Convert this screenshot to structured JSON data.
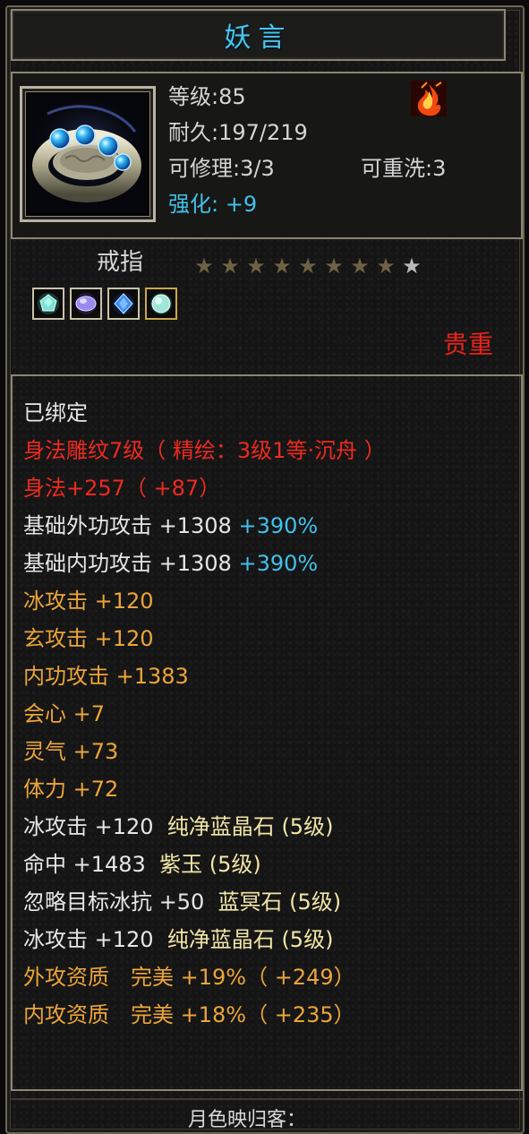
{
  "item": {
    "name": "妖言",
    "level": "等级:85",
    "durability": "耐久:197/219",
    "repairable": "可修理:3/3",
    "rewashable": "可重洗:3",
    "enhance_label": "强化:",
    "enhance_value": "+9",
    "type": "戒指",
    "rarity": "贵重",
    "stars": {
      "filled": 8,
      "total": 9
    },
    "gems": [
      {
        "icon": "green-gem-icon",
        "color": "#7be0d6"
      },
      {
        "icon": "purple-gem-icon",
        "color": "#9a8af0"
      },
      {
        "icon": "blue-gem-icon",
        "color": "#3a8ef0"
      },
      {
        "icon": "aqua-gem-icon",
        "color": "#9fe8d8"
      }
    ],
    "colors": {
      "title": "#4cc3ea",
      "red": "#ee2a20",
      "orange": "#eca53a",
      "blue": "#42c1ea",
      "white": "#e6e6e6"
    }
  },
  "attributes": {
    "bound": "已绑定",
    "engrave": "身法雕纹7级（ 精绘：3级1等·沉舟 ）",
    "agility": "身法+257（ +87）",
    "ext_atk": {
      "text": "基础外功攻击 +1308",
      "pct": "+390%"
    },
    "int_atk": {
      "text": "基础内功攻击 +1308",
      "pct": "+390%"
    },
    "ice_atk": "冰攻击 +120",
    "xuan_atk": "玄攻击 +120",
    "inner_atk": "内功攻击 +1383",
    "crit": "会心 +7",
    "spirit": "灵气 +73",
    "stamina": "体力 +72",
    "gem1": {
      "text": "冰攻击 +120",
      "gem": "纯净蓝晶石 (5级)"
    },
    "gem2": {
      "text": "命中 +1483",
      "gem": "紫玉 (5级)"
    },
    "gem3": {
      "text": "忽略目标冰抗 +50",
      "gem": "蓝冥石 (5级)"
    },
    "gem4": {
      "text": "冰攻击 +120",
      "gem": "纯净蓝晶石 (5级)"
    },
    "ext_quality": "外攻资质　完美 +19%（ +249）",
    "int_quality": "内攻资质　完美 +18%（ +235）"
  },
  "footer": {
    "text": "月色映归客："
  }
}
